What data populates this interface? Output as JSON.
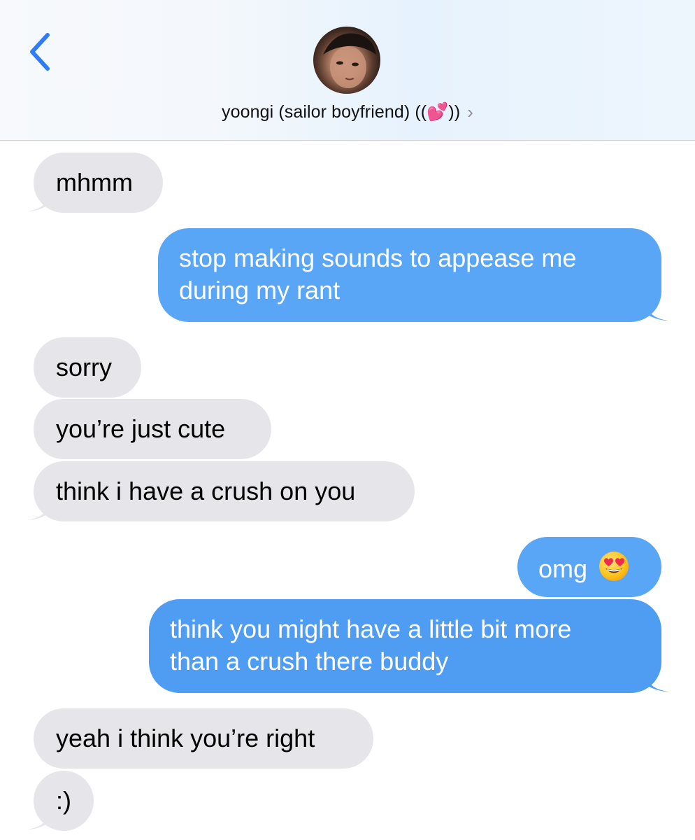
{
  "header": {
    "contact_name": "yoongi (sailor boyfriend) ((💕))",
    "chevron": "›"
  },
  "colors": {
    "incoming_bubble": "#e5e5ea",
    "outgoing_bubble": "#59a6f6",
    "accent": "#2f7cf6"
  },
  "messages": [
    {
      "direction": "incoming",
      "text": "mhmm"
    },
    {
      "direction": "outgoing",
      "lines": [
        "stop making sounds to appease me",
        "during my rant"
      ]
    },
    {
      "direction": "incoming",
      "text": "sorry"
    },
    {
      "direction": "incoming",
      "text": "you’re just cute"
    },
    {
      "direction": "incoming",
      "text": "think i have a crush on you"
    },
    {
      "direction": "outgoing",
      "text": "omg",
      "emoji": "heart-eyes-emoji"
    },
    {
      "direction": "outgoing",
      "lines": [
        "think you might have a little bit more",
        "than a crush there buddy"
      ]
    },
    {
      "direction": "incoming",
      "text": "yeah i think you’re right"
    },
    {
      "direction": "incoming",
      "text": ":)"
    }
  ]
}
